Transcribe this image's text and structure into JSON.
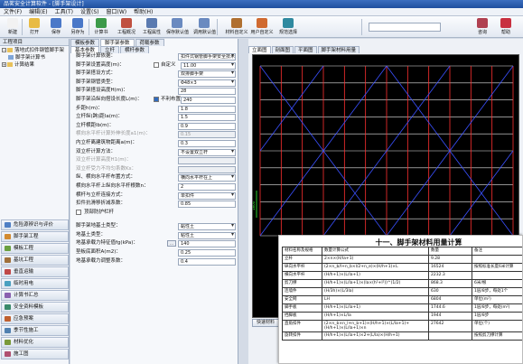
{
  "window": {
    "title": "品茗安全计算软件 - [脚手架设计]"
  },
  "menu": [
    "文件(F)",
    "编辑(E)",
    "工具(T)",
    "设置(S)",
    "窗口(W)",
    "帮助(H)"
  ],
  "toolbar": {
    "buttons": [
      {
        "label": "新建",
        "icon": "new-file-icon",
        "color": "#f2f2f2"
      },
      {
        "label": "打开",
        "icon": "open-folder-icon",
        "color": "#e8bb44"
      },
      {
        "label": "保存",
        "icon": "save-icon",
        "color": "#4a78c8"
      },
      {
        "label": "另存为",
        "icon": "save-as-icon",
        "color": "#4a78c8"
      },
      {
        "label": "计算书",
        "icon": "calc-book-icon",
        "color": "#3c9a4a"
      },
      {
        "label": "工程概况",
        "icon": "project-icon",
        "color": "#c05040"
      },
      {
        "label": "工程属性",
        "icon": "attribute-icon",
        "color": "#5a7ab0"
      },
      {
        "label": "保存默认值",
        "icon": "save-default-icon",
        "color": "#6a8ac0"
      },
      {
        "label": "调用默认值",
        "icon": "load-default-icon",
        "color": "#6a8ac0"
      },
      {
        "label": "材料自定义",
        "icon": "material-icon",
        "color": "#b07030"
      },
      {
        "label": "用户自定义",
        "icon": "user-define-icon",
        "color": "#d06a30"
      },
      {
        "label": "规范选择",
        "icon": "standard-icon",
        "color": "#308aa0"
      },
      {
        "label": "咨询",
        "icon": "consult-icon",
        "color": "#b04050"
      },
      {
        "label": "帮助",
        "icon": "help-icon",
        "color": "#c83040"
      }
    ],
    "search_placeholder": ""
  },
  "left_panel": {
    "title": "工程项目",
    "tree": [
      {
        "label": "落地式扣件钢管脚手架",
        "level": 1
      },
      {
        "label": "脚手架计算书",
        "level": 2
      },
      {
        "label": "计算结果",
        "level": 1
      }
    ],
    "nav": [
      {
        "label": "危险源辨识与评价",
        "color": "#4f7fc4"
      },
      {
        "label": "脚手架工程",
        "color": "#d28a30"
      },
      {
        "label": "模板工程",
        "color": "#6aa040"
      },
      {
        "label": "基坑工程",
        "color": "#a0703a"
      },
      {
        "label": "垂直运输",
        "color": "#c04848"
      },
      {
        "label": "临时用电",
        "color": "#4aa0c0"
      },
      {
        "label": "计算书汇总",
        "color": "#8a60b0"
      },
      {
        "label": "安全资料模板",
        "color": "#3a8a6a"
      },
      {
        "label": "应急预案",
        "color": "#c06030"
      },
      {
        "label": "季节性施工",
        "color": "#5080b0"
      },
      {
        "label": "材料优化",
        "color": "#7a9a3a"
      },
      {
        "label": "施工图",
        "color": "#b05070"
      }
    ]
  },
  "mid_panel": {
    "tabs": [
      "模板参数",
      "脚手架参数",
      "荷载参数"
    ],
    "active_tab": 1,
    "sub_tabs": [
      "基本参数",
      "立杆",
      "横杆参数"
    ],
    "rows": [
      {
        "label": "脚手架计算依据：",
        "value": "扣件式钢管脚手架安全技术规范",
        "type": "select"
      },
      {
        "label": "脚手架设置高度(m)：",
        "value": "11.00",
        "type": "select",
        "checkbox": "自定义"
      },
      {
        "label": "脚手架搭设方式：",
        "value": "双排脚手架",
        "type": "select"
      },
      {
        "label": "脚手架钢管类型：",
        "value": "Φ48×3",
        "type": "select"
      },
      {
        "label": "脚手架搭设高度H(m)：",
        "value": "28",
        "type": "input"
      },
      {
        "label": "脚手架沿纵向搭设长度L(m)：",
        "value": "240",
        "type": "input",
        "checkbox": "不利布置"
      },
      {
        "label": "步距h(m)：",
        "value": "1.8",
        "type": "input"
      },
      {
        "label": "立杆纵(跨)距la(m)：",
        "value": "1.5",
        "type": "input"
      },
      {
        "label": "立杆横距lb(m)：",
        "value": "0.9",
        "type": "input"
      },
      {
        "label": "横向水平杆计算外伸长度a1(m)：",
        "value": "0.15",
        "type": "input",
        "disabled": true
      },
      {
        "label": "内立杆离建筑物距离a(m)：",
        "value": "0.3",
        "type": "input"
      },
      {
        "label": "双立杆计算方法：",
        "value": "不设置双立杆",
        "type": "select"
      },
      {
        "label": "双立杆计算高度H1(m)：",
        "value": "",
        "type": "input",
        "disabled": true
      },
      {
        "label": "双立杆受力不均匀系数Ks：",
        "value": "",
        "type": "input",
        "disabled": true
      },
      {
        "label": "纵、横向水平杆布置方式：",
        "value": "横向水平杆在上",
        "type": "select"
      },
      {
        "label": "横向水平杆上纵向水平杆根数n：",
        "value": "2",
        "type": "input"
      },
      {
        "label": "横杆与立杆连接方式：",
        "value": "单扣件",
        "type": "select"
      },
      {
        "label": "扣件抗滑移折减系数：",
        "value": "0.85",
        "type": "input"
      },
      {
        "label": "",
        "value": "",
        "type": "checkbox-only",
        "checkbox": "顶部防护栏杆"
      },
      {
        "label": "",
        "value": "",
        "type": "spacer"
      },
      {
        "label": "脚手架地基土类型：",
        "value": "黏性土",
        "type": "select"
      },
      {
        "label": "地基土类型：",
        "value": "粘性土",
        "type": "select"
      },
      {
        "label": "地基承载力特征值fg(kPa)：",
        "value": "140",
        "type": "input",
        "button": "..."
      },
      {
        "label": "垫板底面积A(m2)：",
        "value": "0.25",
        "type": "input"
      },
      {
        "label": "地基承载力调整系数：",
        "value": "0.4",
        "type": "input"
      }
    ]
  },
  "right_panel": {
    "tabs": [
      "立面图",
      "剖面图",
      "平面图",
      "脚手架材料用量"
    ],
    "active_tab": 0,
    "bottom_button": "快速材料",
    "dimension_label": "1800"
  },
  "material_doc": {
    "title": "十一、脚手架材料用量计算",
    "headers": [
      "材料名称及规格",
      "数量计算公式",
      "数量",
      "备注"
    ],
    "rows": [
      [
        "立杆",
        "2×n×(H/la+1)",
        "9.28",
        ""
      ],
      [
        "纵向水平杆",
        "(2×n_b/l+n_b×l/2+n_e)×(H/h+1)×L",
        "16524",
        "按照标准长度6米计算"
      ],
      [
        "横向水平杆",
        "(H/h+1)×(L/la+1)",
        "2232.3",
        ""
      ],
      [
        "剪刀撑",
        "(H/h+1)×(L/la+1)×(la×(h²+l²))^(1/2)",
        "868.3",
        "6米/根"
      ],
      [
        "连墙件",
        "(H/3h)×(L/3la)",
        "630",
        "1层/8步，每处1个"
      ],
      [
        "安全网",
        "LH",
        "6804",
        "单位(m²)"
      ],
      [
        "脚手板",
        "(H/h+1)×(L/la+1)",
        "1744.6",
        "1层/8步，每处(m²)"
      ],
      [
        "挡脚板",
        "(H/h+1)×L/la",
        "1944",
        "1层/8步"
      ],
      [
        "直角扣件",
        "(2×n_b×n_l+n_b+1)×(H/h+1)×(L/la+1)+(H/h+1)×(L/la+1)×n",
        "27642",
        "单位(个)"
      ],
      [
        "旋转扣件",
        "(H/h+1)×(L/la+1)×2+(L/la)×(H/h+1)",
        "",
        "按照剪刀撑计算"
      ]
    ]
  }
}
